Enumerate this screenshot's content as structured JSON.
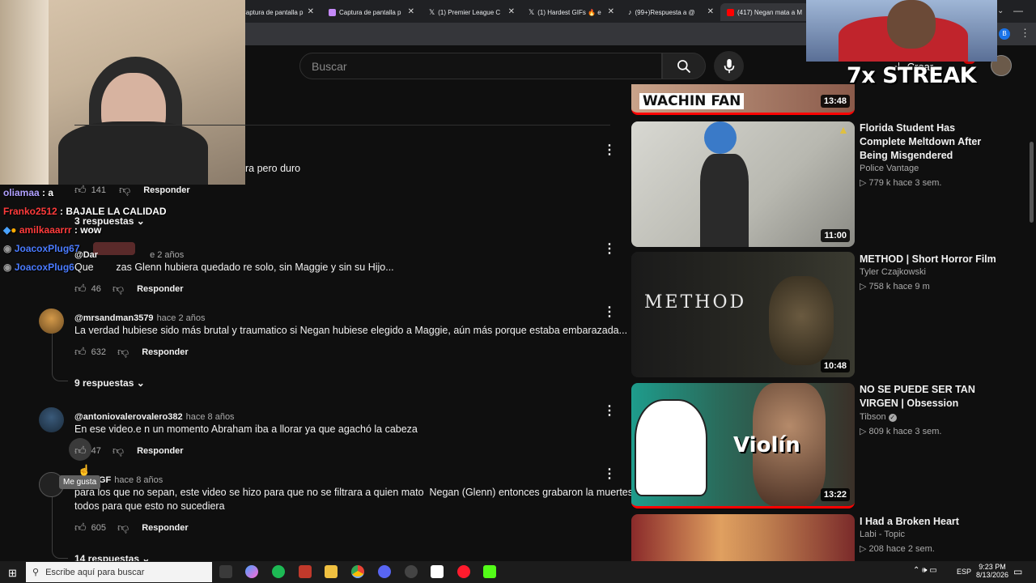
{
  "browser": {
    "tabs": [
      {
        "title": "Captura de pantalla p",
        "icon_color": "#8ab4f8"
      },
      {
        "title": "Captura de pantalla p",
        "icon_color": "#c58af9"
      },
      {
        "title": "(1) Premier League C",
        "icon_color": "#ffffff"
      },
      {
        "title": "(1) Hardest GIFs 🔥 e",
        "icon_color": "#ffffff"
      },
      {
        "title": "(99+)Respuesta a @",
        "icon_color": "#ffffff"
      },
      {
        "title": "(417) Negan mata a M",
        "icon_color": "#ff0000"
      }
    ]
  },
  "youtube": {
    "search_placeholder": "Buscar",
    "create_label": "Crear",
    "notif_count": "9+"
  },
  "stream": {
    "overlay_text": "7x STREAK"
  },
  "comments": {
    "top": {
      "text_fragment": "ra pero duro",
      "likes": "141",
      "reply_label": "Responder",
      "replies_label": "3 respuestas"
    },
    "items": [
      {
        "handle": "@Dar",
        "time": "e 2 años",
        "text": "Que        zas Glenn hubiera quedado re solo, sin Maggie y sin su Hijo...",
        "likes": "46",
        "reply_label": "Responder"
      },
      {
        "handle": "@mrsandman3579",
        "time": "hace 2 años",
        "text": "La verdad hubiese sido más brutal y traumatico si Negan hubiese elegido a Maggie, aún más porque estaba embarazada...",
        "likes": "632",
        "reply_label": "Responder",
        "replies_label": "9 respuestas"
      },
      {
        "handle": "@antoniovalerovalero382",
        "time": "hace 8 años",
        "text": "En ese video.e n un momento Abraham iba a llorar ya que agachó la cabeza",
        "likes": "47",
        "reply_label": "Responder"
      },
      {
        "handle": "GF",
        "time": "hace 8 años",
        "text_line1": "para los que no sepan, este video se hizo para que no se filtrara a quien mato  Negan (Glenn) entonces grabaron la muertes de",
        "text_line2": "todos para que esto no sucediera",
        "likes": "605",
        "reply_label": "Responder",
        "replies_label": "14 respuestas"
      }
    ],
    "tooltip": "Me gusta"
  },
  "chat": [
    {
      "user": "oliamaa",
      "msg": "a",
      "color": "#b0a0ff"
    },
    {
      "user": "Franko2512",
      "msg": "BAJALE LA CALIDAD",
      "color": "#ff3b3b"
    },
    {
      "user": "amilkaaarrr",
      "msg": "wow",
      "color": "#ff3b3b"
    },
    {
      "user": "JoacoxPlug67",
      "msg": "",
      "color": "#4a7bff"
    },
    {
      "user": "JoacoxPlug6",
      "msg": "",
      "color": "#4a7bff"
    }
  ],
  "sidebar": {
    "videos": [
      {
        "title": "",
        "thumb_text": "WACHIN FAN",
        "channel": "",
        "views": "",
        "age": "",
        "duration": "13:48"
      },
      {
        "title": "Florida Student Has Complete Meltdown After Being Misgendered",
        "channel": "Police Vantage",
        "views": "779 k",
        "age": "hace 3 sem.",
        "duration": "11:00"
      },
      {
        "title": "METHOD | Short Horror Film",
        "thumb_text": "METHOD",
        "channel": "Tyler Czajkowski",
        "views": "758 k",
        "age": "hace 9 m",
        "duration": "10:48"
      },
      {
        "title": "NO SE PUEDE SER TAN VIRGEN | Obsession",
        "thumb_text": "Violín",
        "channel": "Tibson",
        "views": "809 k",
        "age": "hace 3 sem.",
        "duration": "13:22"
      },
      {
        "title": "I Had a Broken Heart",
        "channel": "Labi - Topic",
        "views": "208",
        "age": "hace 2 sem.",
        "duration": ""
      }
    ]
  },
  "taskbar": {
    "search_placeholder": "Escribe aquí para buscar",
    "lang": "ESP",
    "time": "9:23 PM",
    "date": "8/13/2026"
  }
}
